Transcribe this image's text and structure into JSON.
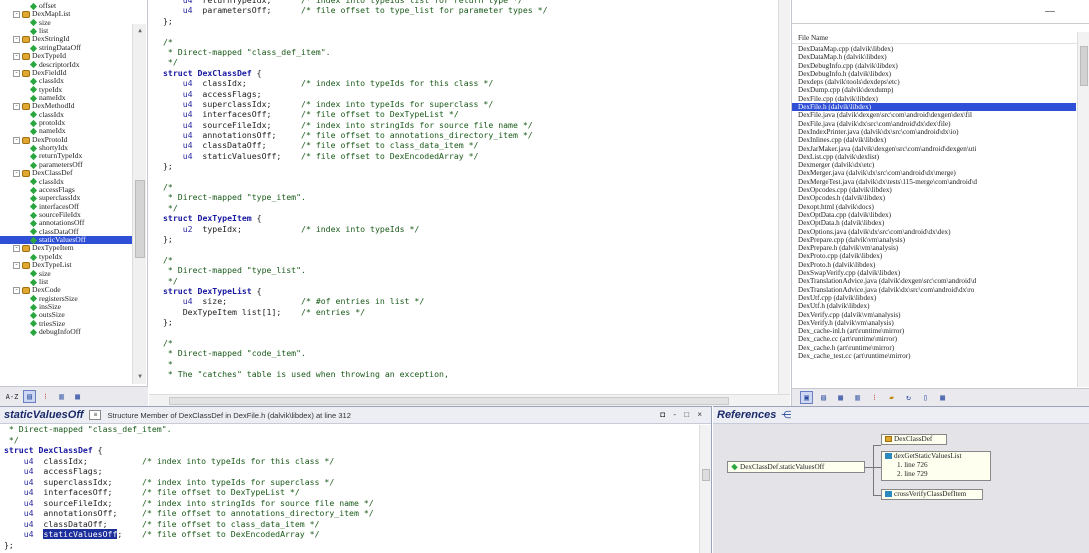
{
  "tree": {
    "items": [
      {
        "label": "offset",
        "level": 1
      },
      {
        "label": "DexMapList",
        "level": 0
      },
      {
        "label": "size",
        "level": 1
      },
      {
        "label": "list",
        "level": 1
      },
      {
        "label": "DexStringId",
        "level": 0
      },
      {
        "label": "stringDataOff",
        "level": 1
      },
      {
        "label": "DexTypeId",
        "level": 0
      },
      {
        "label": "descriptorIdx",
        "level": 1
      },
      {
        "label": "DexFieldId",
        "level": 0
      },
      {
        "label": "classIdx",
        "level": 1
      },
      {
        "label": "typeIdx",
        "level": 1
      },
      {
        "label": "nameIdx",
        "level": 1
      },
      {
        "label": "DexMethodId",
        "level": 0
      },
      {
        "label": "classIdx",
        "level": 1
      },
      {
        "label": "protoIdx",
        "level": 1
      },
      {
        "label": "nameIdx",
        "level": 1
      },
      {
        "label": "DexProtoId",
        "level": 0
      },
      {
        "label": "shortyIdx",
        "level": 1
      },
      {
        "label": "returnTypeIdx",
        "level": 1
      },
      {
        "label": "parametersOff",
        "level": 1
      },
      {
        "label": "DexClassDef",
        "level": 0
      },
      {
        "label": "classIdx",
        "level": 1
      },
      {
        "label": "accessFlags",
        "level": 1
      },
      {
        "label": "superclassIdx",
        "level": 1
      },
      {
        "label": "interfacesOff",
        "level": 1
      },
      {
        "label": "sourceFileIdx",
        "level": 1
      },
      {
        "label": "annotationsOff",
        "level": 1
      },
      {
        "label": "classDataOff",
        "level": 1
      },
      {
        "label": "staticValuesOff",
        "level": 1,
        "selected": true
      },
      {
        "label": "DexTypeItem",
        "level": 0
      },
      {
        "label": "typeIdx",
        "level": 1
      },
      {
        "label": "DexTypeList",
        "level": 0
      },
      {
        "label": "size",
        "level": 1
      },
      {
        "label": "list",
        "level": 1
      },
      {
        "label": "DexCode",
        "level": 0
      },
      {
        "label": "registersSize",
        "level": 1
      },
      {
        "label": "insSize",
        "level": 1
      },
      {
        "label": "outsSize",
        "level": 1
      },
      {
        "label": "triesSize",
        "level": 1
      },
      {
        "label": "debugInfoOff",
        "level": 1
      }
    ],
    "toolbar": {
      "sort_label": "A-Z"
    }
  },
  "editor": {
    "lines": [
      "    u4  returnTypeIdx;      /* index into typeIds list for return type */",
      "    u4  parametersOff;      /* file offset to type_list for parameter types */",
      "};",
      "",
      "/*",
      " * Direct-mapped \"class_def_item\".",
      " */",
      "struct DexClassDef {",
      "    u4  classIdx;           /* index into typeIds for this class */",
      "    u4  accessFlags;",
      "    u4  superclassIdx;      /* index into typeIds for superclass */",
      "    u4  interfacesOff;      /* file offset to DexTypeList */",
      "    u4  sourceFileIdx;      /* index into stringIds for source file name */",
      "    u4  annotationsOff;     /* file offset to annotations_directory_item */",
      "    u4  classDataOff;       /* file offset to class_data_item */",
      "    u4  staticValuesOff;    /* file offset to DexEncodedArray */",
      "};",
      "",
      "/*",
      " * Direct-mapped \"type_item\".",
      " */",
      "struct DexTypeItem {",
      "    u2  typeIdx;            /* index into typeIds */",
      "};",
      "",
      "/*",
      " * Direct-mapped \"type_list\".",
      " */",
      "struct DexTypeList {",
      "    u4  size;               /* #of entries in list */",
      "    DexTypeItem list[1];    /* entries */",
      "};",
      "",
      "/*",
      " * Direct-mapped \"code_item\".",
      " *",
      " * The \"catches\" table is used when throwing an exception,"
    ]
  },
  "files": {
    "header": "File Name",
    "items": [
      "DexDataMap.cpp (dalvik\\libdex)",
      "DexDataMap.h (dalvik\\libdex)",
      "DexDebugInfo.cpp (dalvik\\libdex)",
      "DexDebugInfo.h (dalvik\\libdex)",
      "Dexdeps (dalvik\\tools\\dexdeps\\etc)",
      "DexDump.cpp (dalvik\\dexdump)",
      "DexFile.cpp (dalvik\\libdex)",
      "DexFile.h (dalvik\\libdex)",
      "DexFile.java (dalvik\\dexgen\\src\\com\\android\\dexgen\\dex\\fil",
      "DexFile.java (dalvik\\dx\\src\\com\\android\\dx\\dex\\file)",
      "DexIndexPrinter.java (dalvik\\dx\\src\\com\\android\\dx\\io)",
      "DexInlines.cpp (dalvik\\libdex)",
      "DexJarMaker.java (dalvik\\dexgen\\src\\com\\android\\dexgen\\uti",
      "DexList.cpp (dalvik\\dexlist)",
      "Dexmerger (dalvik\\dx\\etc)",
      "DexMerger.java (dalvik\\dx\\src\\com\\android\\dx\\merge)",
      "DexMergeTest.java (dalvik\\dx\\tests\\115-merge\\com\\android\\d",
      "DexOpcodes.cpp (dalvik\\libdex)",
      "DexOpcodes.h (dalvik\\libdex)",
      "Dexopt.html (dalvik\\docs)",
      "DexOptData.cpp (dalvik\\libdex)",
      "DexOptData.h (dalvik\\libdex)",
      "DexOptions.java (dalvik\\dx\\src\\com\\android\\dx\\dex)",
      "DexPrepare.cpp (dalvik\\vm\\analysis)",
      "DexPrepare.h (dalvik\\vm\\analysis)",
      "DexProto.cpp (dalvik\\libdex)",
      "DexProto.h (dalvik\\libdex)",
      "DexSwapVerify.cpp (dalvik\\libdex)",
      "DexTranslationAdvice.java (dalvik\\dexgen\\src\\com\\android\\d",
      "DexTranslationAdvice.java (dalvik\\dx\\src\\com\\android\\dx\\ro",
      "DexUtf.cpp (dalvik\\libdex)",
      "DexUtf.h (dalvik\\libdex)",
      "DexVerify.cpp (dalvik\\vm\\analysis)",
      "DexVerify.h (dalvik\\vm\\analysis)",
      "Dex_cache-inl.h (art\\runtime\\mirror)",
      "Dex_cache.cc (art\\runtime\\mirror)",
      "Dex_cache.h (art\\runtime\\mirror)",
      "Dex_cache_test.cc (art\\runtime\\mirror)"
    ],
    "selected_index": 7
  },
  "context": {
    "title": "staticValuesOff",
    "description": "Structure Member of DexClassDef in DexFile.h (dalvik\\libdex) at line 312",
    "controls": "◘ - □ ×",
    "lines": [
      " * Direct-mapped \"class_def_item\".",
      " */",
      "struct DexClassDef {",
      "    u4  classIdx;           /* index into typeIds for this class */",
      "    u4  accessFlags;",
      "    u4  superclassIdx;      /* index into typeIds for superclass */",
      "    u4  interfacesOff;      /* file offset to DexTypeList */",
      "    u4  sourceFileIdx;      /* index into stringIds for source file name */",
      "    u4  annotationsOff;     /* file offset to annotations_directory_item */",
      "    u4  classDataOff;       /* file offset to class_data_item */",
      "    u4  staticValuesOff;    /* file offset to DexEncodedArray */",
      "};"
    ],
    "highlight_word": "staticValuesOff"
  },
  "references": {
    "title": "References",
    "root": "DexClassDef.staticValuesOff",
    "parent": "DexClassDef",
    "func1": "dexGetStaticValuesList",
    "line1": "1. line 726",
    "line2": "2. line 729",
    "func2": "crossVerifyClassDefItem"
  }
}
